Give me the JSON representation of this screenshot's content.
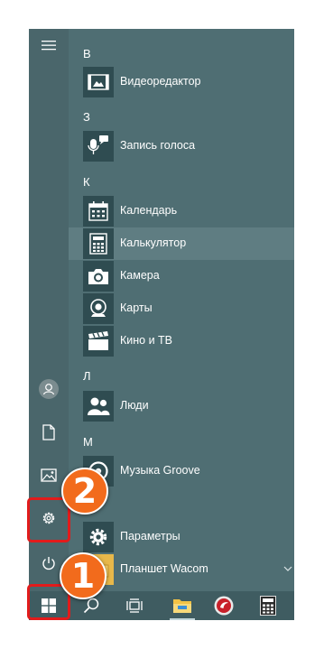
{
  "app_list": {
    "sections": [
      {
        "letter": "В",
        "apps": [
          {
            "label": "Видеоредактор",
            "icon": "video-editor-icon"
          }
        ]
      },
      {
        "letter": "З",
        "apps": [
          {
            "label": "Запись голоса",
            "icon": "voice-recorder-icon"
          }
        ]
      },
      {
        "letter": "К",
        "apps": [
          {
            "label": "Календарь",
            "icon": "calendar-icon"
          },
          {
            "label": "Калькулятор",
            "icon": "calculator-icon",
            "selected": true
          },
          {
            "label": "Камера",
            "icon": "camera-icon"
          },
          {
            "label": "Карты",
            "icon": "maps-icon"
          },
          {
            "label": "Кино и ТВ",
            "icon": "movies-tv-icon"
          }
        ]
      },
      {
        "letter": "Л",
        "apps": [
          {
            "label": "Люди",
            "icon": "people-icon"
          }
        ]
      },
      {
        "letter": "М",
        "apps": [
          {
            "label": "Музыка Groove",
            "icon": "groove-music-icon"
          }
        ]
      },
      {
        "letter": "",
        "apps": [
          {
            "label": "Параметры",
            "icon": "gear-icon"
          },
          {
            "label": "Планшет Wacom",
            "icon": "folder-icon"
          }
        ]
      }
    ]
  },
  "rail": [
    "hamburger-menu-icon",
    "user-avatar-icon",
    "documents-icon",
    "pictures-icon",
    "settings-gear-icon",
    "power-icon"
  ],
  "taskbar": [
    "windows-start-icon",
    "search-icon",
    "task-view-icon",
    "file-explorer-icon",
    "app-icon",
    "calculator-icon"
  ],
  "annotations": {
    "marker_1": "1",
    "marker_2": "2",
    "highlight_color": "#e21b1b",
    "marker_color": "#f26b1c"
  },
  "colors": {
    "menu_bg": "#4f6e73",
    "tile_bg": "#2f4c51",
    "taskbar_bg": "#3f5c61"
  }
}
